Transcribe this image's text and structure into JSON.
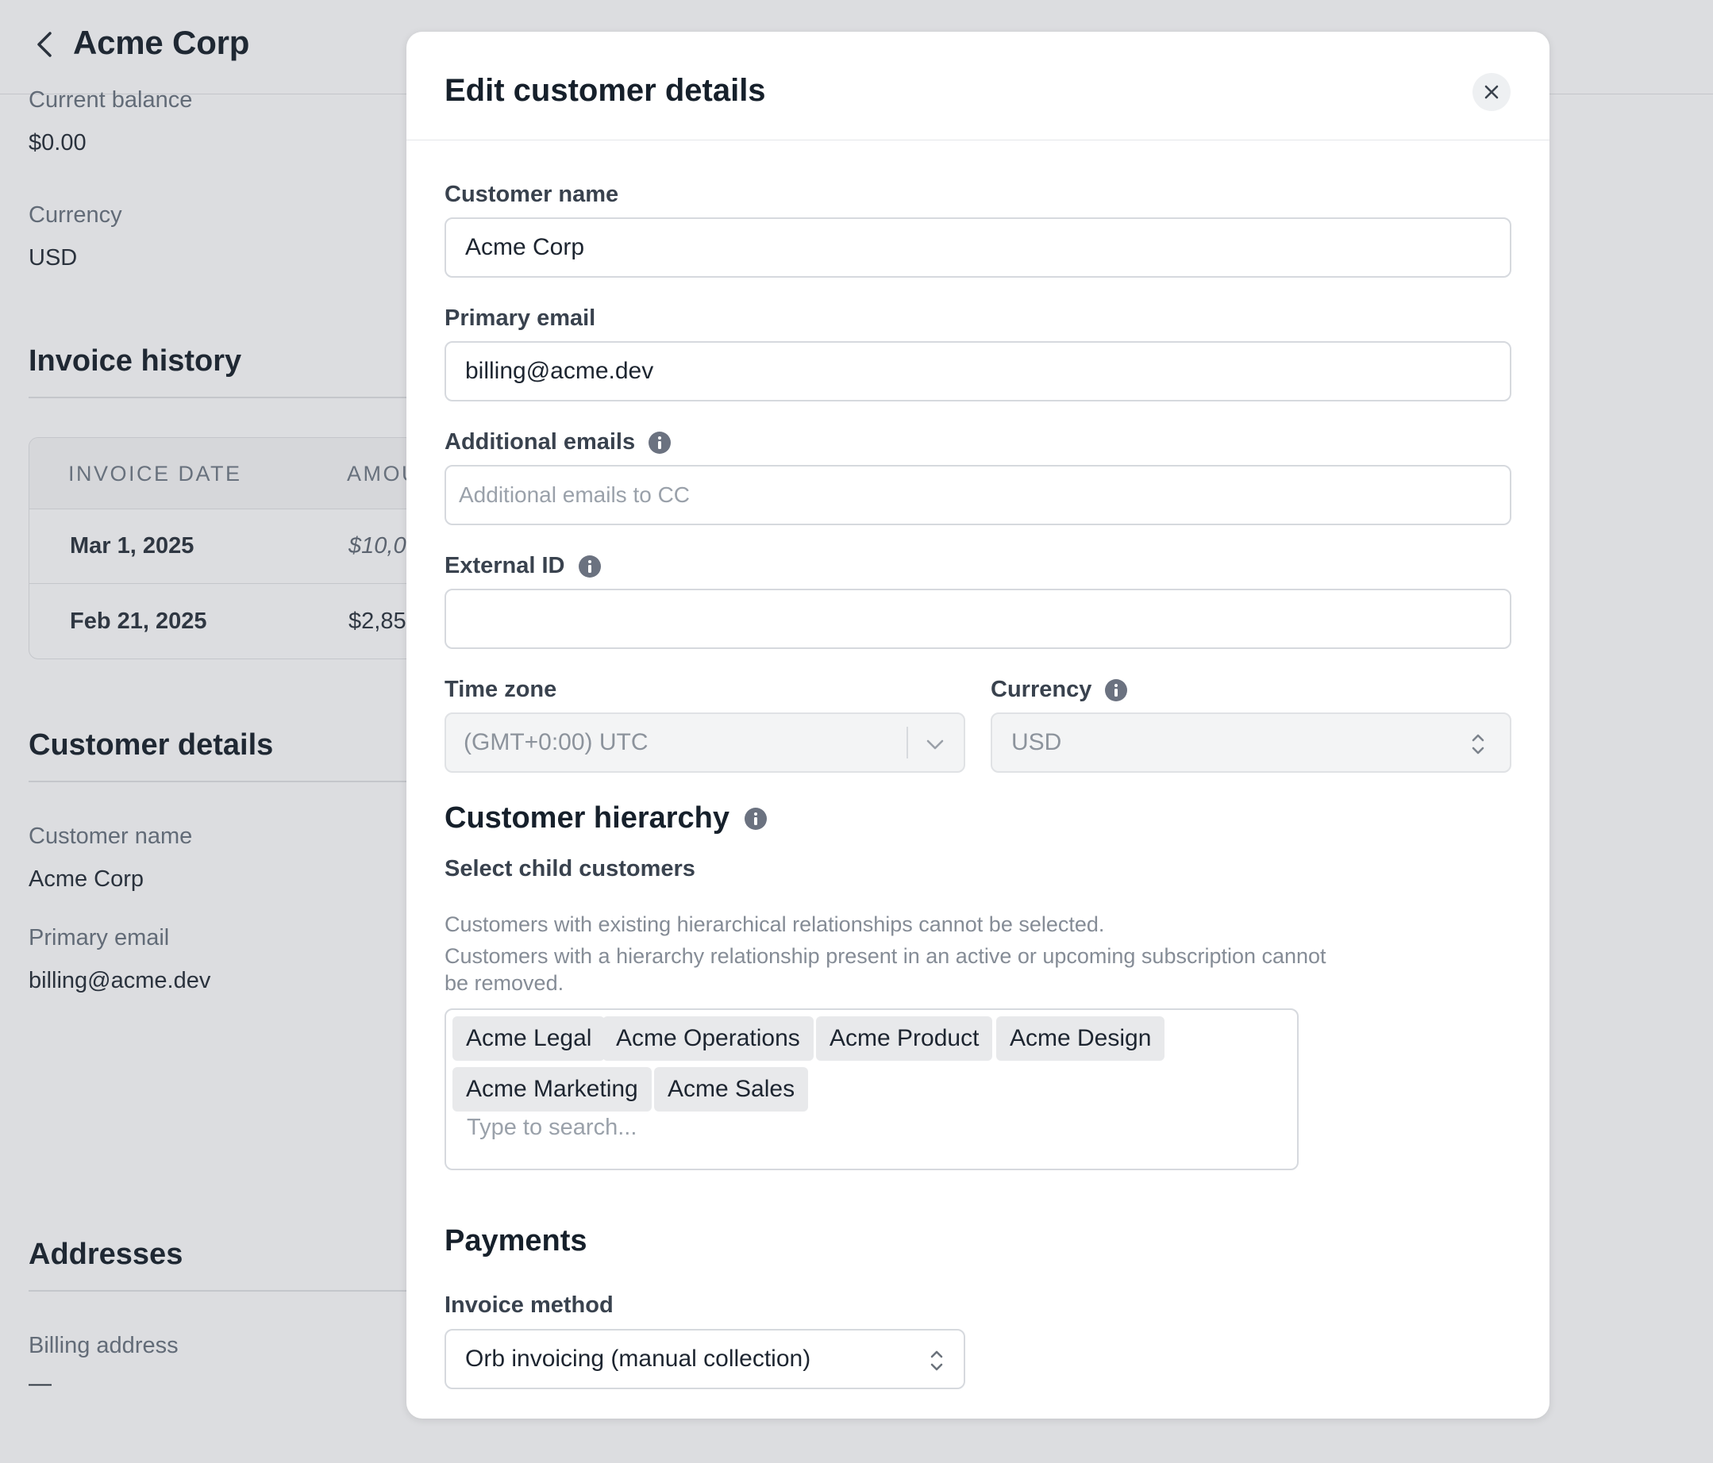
{
  "background": {
    "title": "Acme Corp",
    "current_balance_label": "Current balance",
    "current_balance_value": "$0.00",
    "currency_label": "Currency",
    "currency_value": "USD",
    "invoice_history_heading": "Invoice history",
    "invoice_table": {
      "headers": [
        "INVOICE DATE",
        "AMOU"
      ],
      "rows": [
        {
          "date": "Mar 1, 2025",
          "amount": "$10,0"
        },
        {
          "date": "Feb 21, 2025",
          "amount": "$2,85"
        }
      ]
    },
    "customer_details_heading": "Customer details",
    "customer_name_label": "Customer name",
    "customer_name_value": "Acme Corp",
    "primary_email_label": "Primary email",
    "primary_email_value": "billing@acme.dev",
    "addresses_heading": "Addresses",
    "billing_address_label": "Billing address",
    "billing_address_value": "—"
  },
  "modal": {
    "title": "Edit customer details",
    "close_icon": "close-icon",
    "fields": {
      "customer_name": {
        "label": "Customer name",
        "value": "Acme Corp"
      },
      "primary_email": {
        "label": "Primary email",
        "value": "billing@acme.dev"
      },
      "additional_emails": {
        "label": "Additional emails",
        "placeholder": "Additional emails to CC"
      },
      "external_id": {
        "label": "External ID",
        "value": ""
      },
      "time_zone": {
        "label": "Time zone",
        "value": "(GMT+0:00) UTC"
      },
      "currency": {
        "label": "Currency",
        "value": "USD"
      }
    },
    "hierarchy": {
      "heading": "Customer hierarchy",
      "select_label": "Select child customers",
      "help_line_1": "Customers with existing hierarchical relationships cannot be selected.",
      "help_line_2": "Customers with a hierarchy relationship present in an active or upcoming subscription cannot be removed.",
      "tags": [
        "Acme Legal",
        "Acme Operations",
        "Acme Product",
        "Acme Design",
        "Acme Marketing",
        "Acme Sales"
      ],
      "search_placeholder": "Type to search..."
    },
    "payments": {
      "heading": "Payments",
      "invoice_method_label": "Invoice method",
      "invoice_method_value": "Orb invoicing (manual collection)"
    }
  },
  "colors": {
    "overlay_bg": "#dcdde0",
    "modal_bg": "#ffffff",
    "info_icon": "#6b7280",
    "tag_bg": "#e8e9eb"
  }
}
